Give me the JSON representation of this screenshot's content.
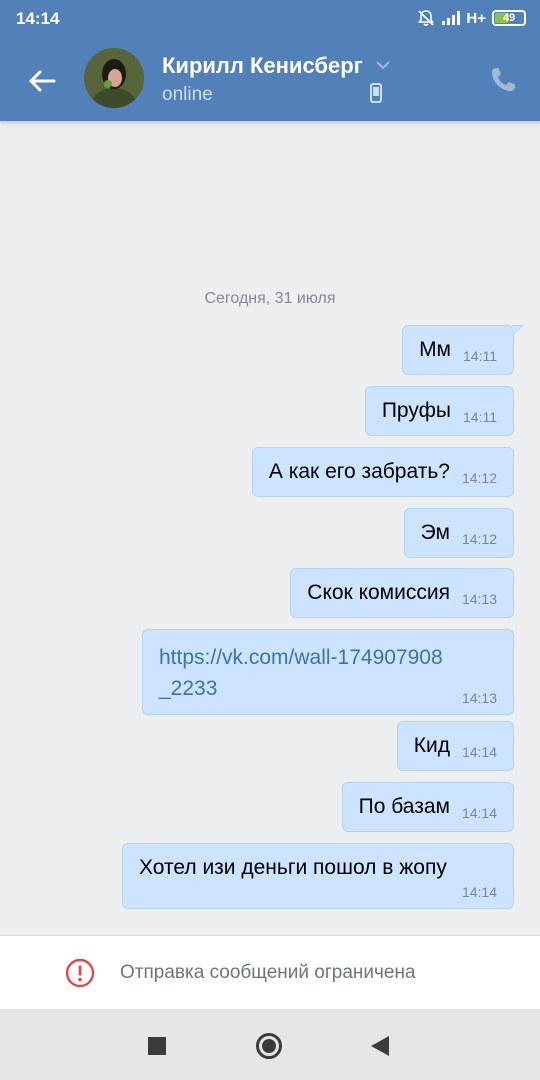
{
  "status_bar": {
    "time": "14:14",
    "network": "H+",
    "battery": "49",
    "battery_level": 0.49
  },
  "header": {
    "contact_name": "Кирилл Кенисберг",
    "status": "online"
  },
  "chat": {
    "date_separator": "Сегодня, 31 июля",
    "messages": [
      {
        "text": "Мм",
        "time": "14:11"
      },
      {
        "text": "Пруфы",
        "time": "14:11"
      },
      {
        "text": "А как его забрать?",
        "time": "14:12"
      },
      {
        "text": "Эм",
        "time": "14:12"
      },
      {
        "text": "Скок комиссия",
        "time": "14:13"
      },
      {
        "text_line1": "https://vk.com/wall-174907908",
        "text_line2": "_2233",
        "time": "14:13"
      },
      {
        "text": "Кид",
        "time": "14:14"
      },
      {
        "text": "По базам",
        "time": "14:14"
      },
      {
        "text": "Хотел изи деньги пошол в жопу",
        "time": "14:14"
      }
    ]
  },
  "composer": {
    "restricted_text": "Отправка сообщений ограничена"
  },
  "colors": {
    "header": "#5181b8",
    "bubble": "#cce4ff",
    "background": "#edeef0",
    "warning": "#e64646",
    "link": "#3f72a5"
  }
}
